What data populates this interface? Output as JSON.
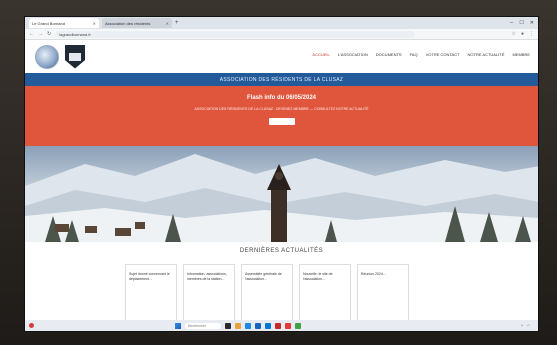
{
  "browser": {
    "tabs": [
      {
        "label": "Le Grand Bornand"
      },
      {
        "label": "Association des résidents"
      }
    ],
    "new_tab": "+",
    "url": "lagrandbornand.fr"
  },
  "site": {
    "nav": [
      {
        "label": "ACCUEIL"
      },
      {
        "label": "L'ASSOCIATION"
      },
      {
        "label": "DOCUMENTS"
      },
      {
        "label": "FAQ"
      },
      {
        "label": "VOTRE CONTACT"
      },
      {
        "label": "NOTRE ACTUALITÉ"
      },
      {
        "label": "MEMBRE"
      }
    ],
    "band_text": "ASSOCIATION DES RÉSIDENTS DE LA CLUSAZ",
    "flash_title": "Flash info du 06/05/2024",
    "flash_text": "ASSOCIATION DES RÉSIDENTS DE LA CLUSAZ : DEVENEZ MEMBRE — CONSULTEZ NOTRE ACTUALITÉ",
    "section_title": "DERNIÈRES ACTUALITÉS",
    "cards": [
      {
        "date": "",
        "title": "",
        "body": "Sujet donné concernant le déplacement..."
      },
      {
        "date": "",
        "title": "",
        "body": "Information, associations, membres de la station..."
      },
      {
        "date": "",
        "title": "",
        "body": "Assemblée générale de l'association..."
      },
      {
        "date": "",
        "title": "",
        "body": "Nouvelle: le site de l'association..."
      },
      {
        "date": "",
        "title": "",
        "body": "Réunion 2024..."
      }
    ]
  },
  "taskbar": {
    "weather": "",
    "search_placeholder": "Rechercher",
    "time": ""
  },
  "colors": {
    "band": "#235a9a",
    "flash": "#e0563c",
    "nav_active": "#c0392b"
  }
}
